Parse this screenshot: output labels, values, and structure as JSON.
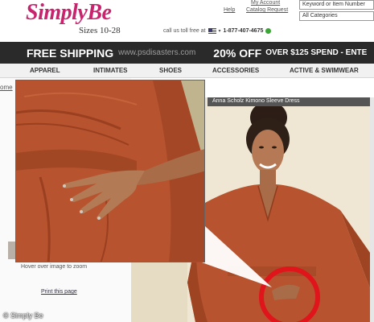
{
  "header": {
    "logo": "SimplyBe",
    "sizes": "Sizes 10-28",
    "my_account": "My Account",
    "help": "Help",
    "catalog_request": "Catalog Request",
    "call_text": "call us toll free at",
    "phone": "1-877-407-4675",
    "search_placeholder": "Keyword or Item Number",
    "category_select": "All Categories"
  },
  "banner": {
    "free": "FREE SHIPPING",
    "watermark": "www.psdisasters.com",
    "off": "20% OFF",
    "spend": "OVER $125 SPEND - ENTE"
  },
  "nav": {
    "items": [
      "APPAREL",
      "INTIMATES",
      "SHOES",
      "ACCESSORIES",
      "ACTIVE & SWIMWEAR"
    ]
  },
  "product": {
    "title": "Anna Scholz Kimono Sleeve Dress",
    "hover_note": "Hover over image to zoom",
    "print_link": "Print this page",
    "home_stub": "ome"
  },
  "credit": "© Simply Be",
  "colors": {
    "brand": "#c8246e",
    "dress": "#b7532e",
    "banner_bg": "#2a2a2a",
    "highlight_circle": "#e0151b"
  }
}
